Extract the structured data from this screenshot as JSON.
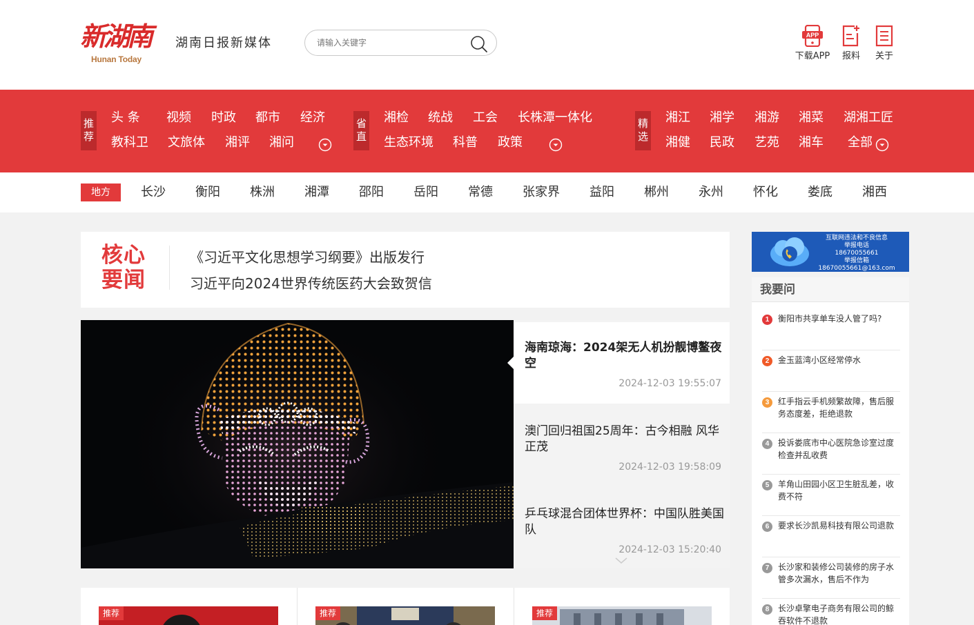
{
  "header": {
    "logo_cn": "新湖南",
    "logo_en": "Hunan Today",
    "tagline": "湖南日报新媒体",
    "search_placeholder": "请输入关键字",
    "tools": {
      "app_label": "下载APP",
      "report_label": "报料",
      "about_label": "关于",
      "app_badge": "APP"
    }
  },
  "nav": {
    "tuijian": {
      "tag": "推荐",
      "row1": [
        "头 条",
        "视频",
        "时政",
        "都市",
        "经济"
      ],
      "row2": [
        "教科卫",
        "文旅体",
        "湘评",
        "湘问"
      ]
    },
    "shengzhi": {
      "tag": "省直",
      "row1": [
        "湘检",
        "统战",
        "工会",
        "长株潭一体化"
      ],
      "row2": [
        "生态环境",
        "科普",
        "政策"
      ]
    },
    "jingxuan": {
      "tag": "精选",
      "row1": [
        "湘江",
        "湘学",
        "湘游",
        "湘菜",
        "湖湘工匠"
      ],
      "row2": [
        "湘健",
        "民政",
        "艺苑",
        "湘车",
        "全部"
      ]
    }
  },
  "local": {
    "tag": "地方",
    "cities": [
      "长沙",
      "衡阳",
      "株洲",
      "湘潭",
      "邵阳",
      "岳阳",
      "常德",
      "张家界",
      "益阳",
      "郴州",
      "永州",
      "怀化",
      "娄底",
      "湘西"
    ]
  },
  "core_news": {
    "title": "核心要闻",
    "items": [
      "《习近平文化思想学习纲要》出版发行",
      "习近平向2024世界传统医药大会致贺信"
    ]
  },
  "slider": {
    "items": [
      {
        "title": "海南琼海：2024架无人机扮靓博鳌夜空",
        "time": "2024-12-03 19:55:07"
      },
      {
        "title": "澳门回归祖国25周年：古今相融 风华正茂",
        "time": "2024-12-03 19:58:09"
      },
      {
        "title": "乒乓球混合团体世界杯：中国队胜美国队",
        "time": "2024-12-03 15:20:40"
      }
    ]
  },
  "cards": {
    "badge": "推荐"
  },
  "ad": {
    "lines": [
      "互联网违法和不良信息",
      "举报电话",
      "18670055661",
      "举报信箱",
      "18670055661@163.com"
    ]
  },
  "ask": {
    "title": "我要问",
    "items": [
      {
        "num": "1",
        "text": "衡阳市共享单车没人管了吗?"
      },
      {
        "num": "2",
        "text": "金玉蓝湾小区经常停水"
      },
      {
        "num": "3",
        "text": "红手指云手机频繁故障，售后服务态度差，拒绝退款"
      },
      {
        "num": "4",
        "text": "投诉娄底市中心医院急诊室过度检查并乱收费"
      },
      {
        "num": "5",
        "text": "羊角山田园小区卫生脏乱差，收费不符"
      },
      {
        "num": "6",
        "text": "要求长沙凯易科技有限公司退款"
      },
      {
        "num": "7",
        "text": "长沙家和装修公司装修的房子水管多次漏水，售后不作为"
      },
      {
        "num": "8",
        "text": "长沙卓擎电子商务有限公司的鲸吞软件不退款"
      }
    ],
    "num_colors": [
      "#e23a3b",
      "#f05a28",
      "#f59a3c",
      "#999999",
      "#999999",
      "#999999",
      "#999999",
      "#999999"
    ]
  },
  "colors": {
    "brand_red": "#e23a3b",
    "dark_red": "#bc2a2c",
    "logo_gold": "#b8773e"
  }
}
